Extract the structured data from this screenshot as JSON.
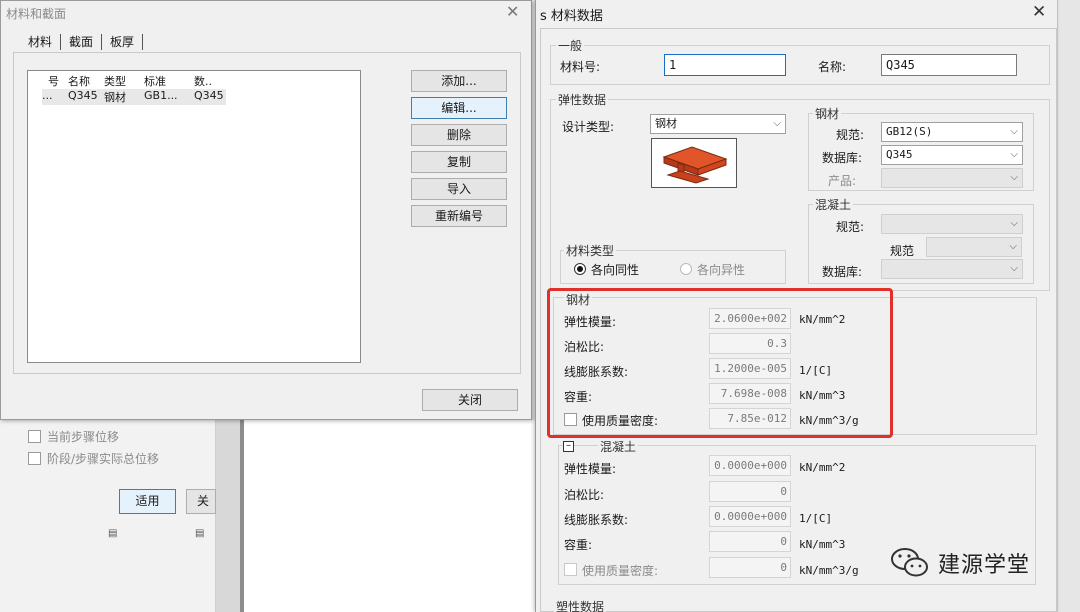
{
  "left_dialog": {
    "title": "材料和截面",
    "tabs": [
      "材料",
      "截面",
      "板厚"
    ],
    "columns": [
      "号",
      "名称",
      "类型",
      "标准",
      "数.."
    ],
    "rows": [
      [
        "...",
        "Q345",
        "钢材",
        "GB1...",
        "Q345"
      ]
    ],
    "buttons": [
      "添加...",
      "编辑...",
      "删除",
      "复制",
      "导入",
      "重新编号"
    ],
    "close": "关闭"
  },
  "background": {
    "checks": [
      "当前步骤位移",
      "阶段/步骤实际总位移"
    ],
    "apply": "适用",
    "close_partial": "关闭"
  },
  "material_dialog": {
    "title": "s 材料数据",
    "general": {
      "label": "一般",
      "mat_no_label": "材料号:",
      "mat_no": "1",
      "name_label": "名称:",
      "name": "Q345"
    },
    "elastic": {
      "label": "弹性数据",
      "design_type_label": "设计类型:",
      "design_type": "钢材"
    },
    "steel_group": {
      "label": "钢材",
      "code_label": "规范:",
      "code": "GB12(S)",
      "db_label": "数据库:",
      "db": "Q345",
      "product_label": "产品:"
    },
    "concrete_group": {
      "label": "混凝土",
      "code_label": "规范:",
      "code2_label": "规范",
      "db_label": "数据库:"
    },
    "material_type": {
      "label": "材料类型",
      "iso": "各向同性",
      "aniso": "各向异性"
    },
    "steel_props": {
      "label": "钢材",
      "e_label": "弹性模量:",
      "e": "2.0600e+002",
      "e_unit": "kN/mm^2",
      "nu_label": "泊松比:",
      "nu": "0.3",
      "alpha_label": "线膨胀系数:",
      "alpha": "1.2000e-005",
      "alpha_unit": "1/[C]",
      "w_label": "容重:",
      "w": "7.698e-008",
      "w_unit": "kN/mm^3",
      "mass_label": "使用质量密度:",
      "mass": "7.85e-012",
      "mass_unit": "kN/mm^3/g"
    },
    "concrete_props": {
      "label": "混凝土",
      "e_label": "弹性模量:",
      "e": "0.0000e+000",
      "e_unit": "kN/mm^2",
      "nu_label": "泊松比:",
      "nu": "0",
      "alpha_label": "线膨胀系数:",
      "alpha": "0.0000e+000",
      "alpha_unit": "1/[C]",
      "w_label": "容重:",
      "w": "0",
      "w_unit": "kN/mm^3",
      "mass_label": "使用质量密度:",
      "mass": "0",
      "mass_unit": "kN/mm^3/g"
    },
    "plastic_label": "塑性数据"
  },
  "watermark": "建源学堂",
  "colors": {
    "highlight_border": "#e0302a",
    "steel": "#d2461e"
  }
}
